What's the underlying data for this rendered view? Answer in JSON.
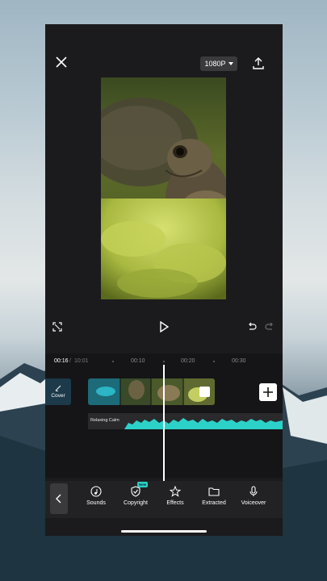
{
  "topbar": {
    "close_icon": "close-icon",
    "resolution_label": "1080P",
    "export_icon": "upload-icon"
  },
  "controls": {
    "fullscreen_icon": "fullscreen-icon",
    "play_icon": "play-icon",
    "undo_icon": "undo-icon",
    "redo_icon": "redo-icon"
  },
  "timeline": {
    "current_time": "00:16",
    "separator": "/",
    "total_time": "10:01",
    "ticks": [
      "00:10",
      "00:20",
      "00:30"
    ],
    "cover_label": "Cover",
    "audio_label": "Relaxing Calm",
    "accent_color": "#2cd2c8"
  },
  "toolbar": {
    "items": [
      {
        "label": "Sounds",
        "icon": "music-note-icon"
      },
      {
        "label": "Copyright",
        "icon": "shield-check-icon",
        "badge": "New"
      },
      {
        "label": "Effects",
        "icon": "star-sparkle-icon"
      },
      {
        "label": "Extracted",
        "icon": "folder-icon"
      },
      {
        "label": "Voiceover",
        "icon": "microphone-icon"
      }
    ]
  }
}
